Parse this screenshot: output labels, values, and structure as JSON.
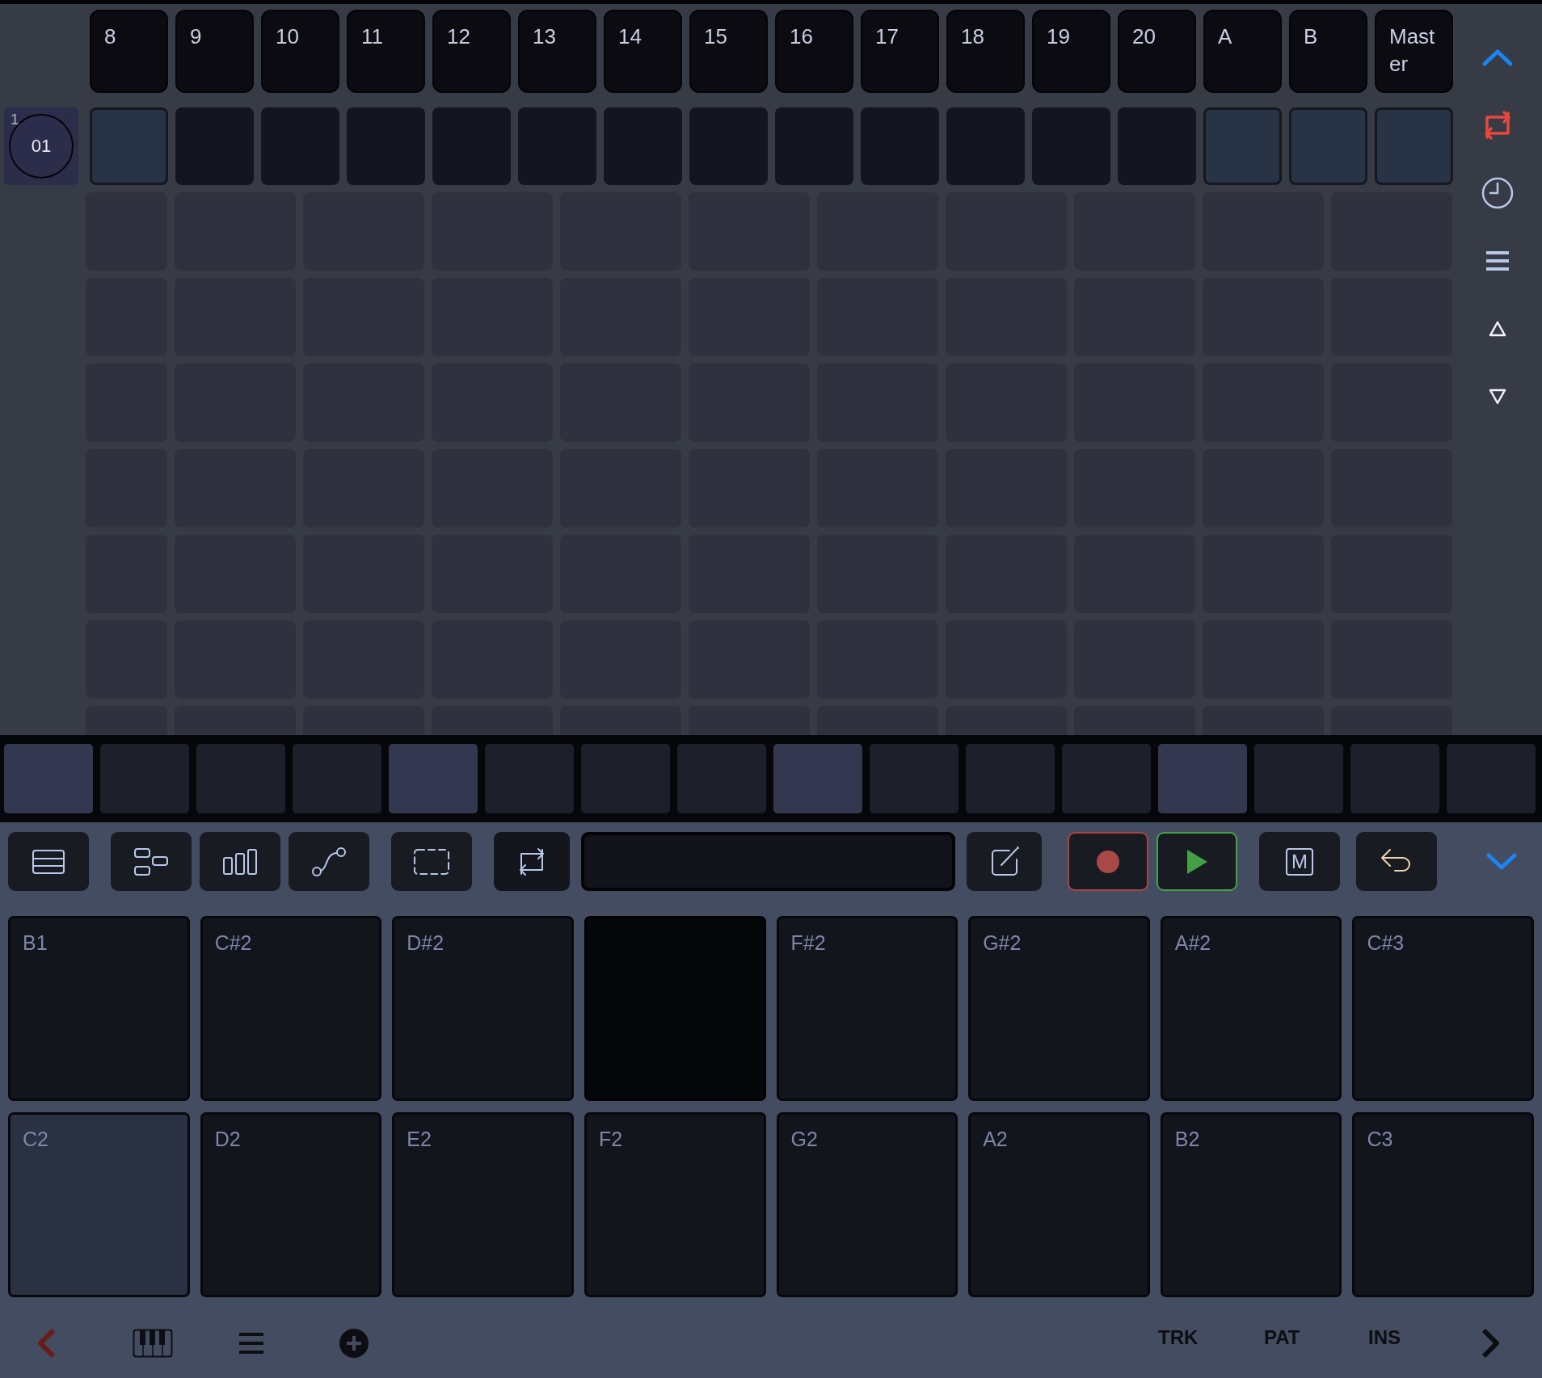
{
  "tracks": [
    {
      "label": "8"
    },
    {
      "label": "9"
    },
    {
      "label": "10"
    },
    {
      "label": "11"
    },
    {
      "label": "12"
    },
    {
      "label": "13"
    },
    {
      "label": "14"
    },
    {
      "label": "15"
    },
    {
      "label": "16"
    },
    {
      "label": "17"
    },
    {
      "label": "18"
    },
    {
      "label": "19"
    },
    {
      "label": "20"
    },
    {
      "label": "A"
    },
    {
      "label": "B"
    },
    {
      "label": "Master"
    }
  ],
  "pattern_row": {
    "row_number": "1",
    "pattern": "01",
    "cells": [
      {
        "filled": true
      },
      {
        "filled": false
      },
      {
        "filled": false
      },
      {
        "filled": false
      },
      {
        "filled": false
      },
      {
        "filled": false
      },
      {
        "filled": false
      },
      {
        "filled": false
      },
      {
        "filled": false
      },
      {
        "filled": false
      },
      {
        "filled": false
      },
      {
        "filled": false
      },
      {
        "filled": false
      },
      {
        "filled": true
      },
      {
        "filled": true
      },
      {
        "filled": true
      }
    ]
  },
  "sidebar": {
    "loop": true
  },
  "steps": [
    {
      "accent": true
    },
    {
      "accent": false
    },
    {
      "accent": false
    },
    {
      "accent": false
    },
    {
      "accent": true
    },
    {
      "accent": false
    },
    {
      "accent": false
    },
    {
      "accent": false
    },
    {
      "accent": true
    },
    {
      "accent": false
    },
    {
      "accent": false
    },
    {
      "accent": false
    },
    {
      "accent": true
    },
    {
      "accent": false
    },
    {
      "accent": false
    },
    {
      "accent": false
    }
  ],
  "toolbar": [
    {
      "kind": "list"
    },
    {
      "kind": "blocks"
    },
    {
      "kind": "bars"
    },
    {
      "kind": "curve"
    },
    {
      "kind": "select"
    },
    {
      "kind": "loop"
    },
    {
      "kind": "display"
    },
    {
      "kind": "edit"
    },
    {
      "kind": "record"
    },
    {
      "kind": "play"
    },
    {
      "kind": "mute",
      "label": "M"
    },
    {
      "kind": "undo"
    }
  ],
  "pads": [
    {
      "label": "B1",
      "selected": false,
      "disabled": false
    },
    {
      "label": "C#2",
      "selected": false,
      "disabled": false
    },
    {
      "label": "D#2",
      "selected": false,
      "disabled": false
    },
    {
      "selected": false,
      "disabled": true
    },
    {
      "label": "F#2",
      "selected": false,
      "disabled": false
    },
    {
      "label": "G#2",
      "selected": false,
      "disabled": false
    },
    {
      "label": "A#2",
      "selected": false,
      "disabled": false
    },
    {
      "label": "C#3",
      "selected": false,
      "disabled": false
    },
    {
      "label": "C2",
      "selected": true,
      "disabled": false
    },
    {
      "label": "D2",
      "selected": false,
      "disabled": false
    },
    {
      "label": "E2",
      "selected": false,
      "disabled": false
    },
    {
      "label": "F2",
      "selected": false,
      "disabled": false
    },
    {
      "label": "G2",
      "selected": false,
      "disabled": false
    },
    {
      "label": "A2",
      "selected": false,
      "disabled": false
    },
    {
      "label": "B2",
      "selected": false,
      "disabled": false
    },
    {
      "label": "C3",
      "selected": false,
      "disabled": false
    }
  ],
  "nav": {
    "items": [
      {
        "kind": "back"
      },
      {
        "kind": "piano"
      },
      {
        "kind": "menu"
      },
      {
        "kind": "add"
      }
    ],
    "tabs": [
      {
        "label": "TRK"
      },
      {
        "label": "PAT"
      },
      {
        "label": "INS"
      }
    ]
  }
}
